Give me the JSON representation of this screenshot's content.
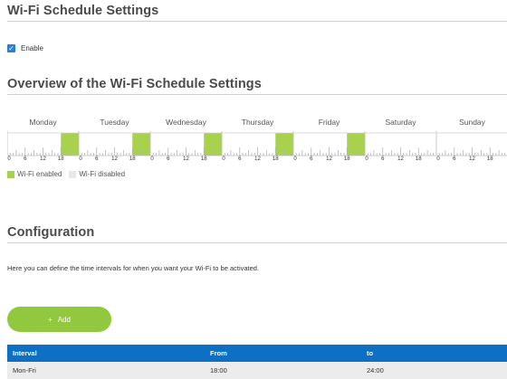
{
  "wifi_schedule_settings": {
    "title": "Wi-Fi Schedule Settings",
    "enable_label": "Enable",
    "enable_checked": true
  },
  "overview": {
    "title": "Overview of the Wi-Fi Schedule Settings",
    "days": [
      "Monday",
      "Tuesday",
      "Wednesday",
      "Thursday",
      "Friday",
      "Saturday",
      "Sunday"
    ],
    "hour_labels": [
      "0",
      "6",
      "12",
      "18"
    ],
    "enabled_color": "#a8d24d",
    "enabled_intervals": [
      {
        "day": "Monday",
        "from_hour": 18,
        "to_hour": 24
      },
      {
        "day": "Tuesday",
        "from_hour": 18,
        "to_hour": 24
      },
      {
        "day": "Wednesday",
        "from_hour": 18,
        "to_hour": 24
      },
      {
        "day": "Thursday",
        "from_hour": 18,
        "to_hour": 24
      },
      {
        "day": "Friday",
        "from_hour": 18,
        "to_hour": 24
      }
    ],
    "legend": {
      "enabled": "Wi-Fi enabled",
      "disabled": "Wi-Fi disabled"
    }
  },
  "configuration": {
    "title": "Configuration",
    "description": "Here you can define the time intervals for when you want your Wi-Fi to be activated.",
    "add_button": {
      "icon": "plus-icon",
      "label": "Add"
    },
    "table": {
      "header_color": "#0e70c4",
      "columns": [
        "Interval",
        "From",
        "to"
      ],
      "rows": [
        [
          "Mon-Fri",
          "18:00",
          "24:00"
        ]
      ]
    }
  }
}
